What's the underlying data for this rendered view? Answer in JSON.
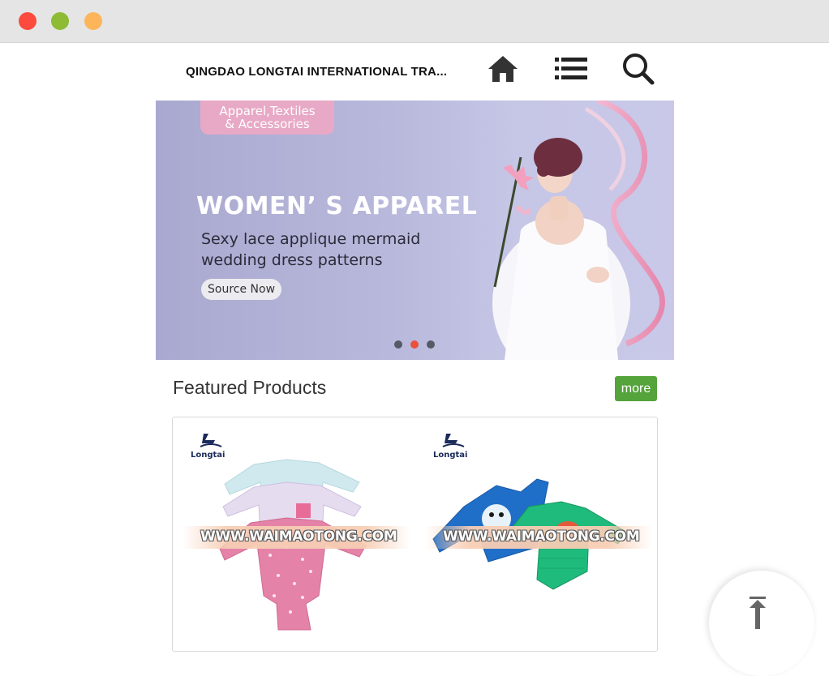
{
  "window": {
    "controls": [
      "close",
      "minimize",
      "maximize"
    ]
  },
  "header": {
    "company_name": "QINGDAO LONGTAI INTERNATIONAL TRA...",
    "icons": [
      "home-icon",
      "menu-list-icon",
      "search-icon"
    ]
  },
  "banner": {
    "tag_line1": "Apparel,Textiles",
    "tag_line2": "& Accessories",
    "headline": "WOMEN’ S APPAREL",
    "sub_line1": "Sexy lace applique mermaid",
    "sub_line2": "wedding dress patterns",
    "cta_label": "Source Now",
    "slides": 3,
    "active_slide": 2
  },
  "featured": {
    "title": "Featured Products",
    "more_label": "more",
    "products": [
      {
        "brand": "Longtai",
        "watermark": "WWW.WAIMAOTONG.COM"
      },
      {
        "brand": "Longtai",
        "watermark": "WWW.WAIMAOTONG.COM"
      }
    ]
  },
  "colors": {
    "accent_green": "#54a33b",
    "active_dot": "#e8523a",
    "banner_bg": "#b8b8dc",
    "tag_pink": "#e8a9c6"
  }
}
